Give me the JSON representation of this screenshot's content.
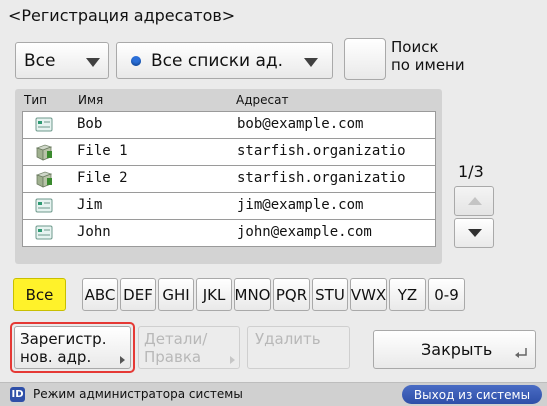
{
  "screen": {
    "title": "<Регистрация адресатов>"
  },
  "filters": {
    "type_filter": "Все",
    "list_filter": "Все списки ад.",
    "search_button_label": "Поиск\nпо имени"
  },
  "table": {
    "headers": {
      "type": "Тип",
      "name": "Имя",
      "address": "Адресат"
    },
    "rows": [
      {
        "type_icon": "address-card-icon",
        "name": "Bob",
        "address": "bob@example.com"
      },
      {
        "type_icon": "file-server-icon",
        "name": "File 1",
        "address": "starfish.organizatio"
      },
      {
        "type_icon": "file-server-icon",
        "name": "File 2",
        "address": "starfish.organizatio"
      },
      {
        "type_icon": "address-card-icon",
        "name": "Jim",
        "address": "jim@example.com"
      },
      {
        "type_icon": "address-card-icon",
        "name": "John",
        "address": "john@example.com"
      }
    ]
  },
  "pager": {
    "page_indicator": "1/3",
    "up_icon": "scroll-up-icon",
    "down_icon": "scroll-down-icon"
  },
  "alpha_tabs": [
    {
      "label": "Все",
      "active": true
    },
    {
      "label": "ABC",
      "active": false
    },
    {
      "label": "DEF",
      "active": false
    },
    {
      "label": "GHI",
      "active": false
    },
    {
      "label": "JKL",
      "active": false
    },
    {
      "label": "MNO",
      "active": false
    },
    {
      "label": "PQR",
      "active": false
    },
    {
      "label": "STU",
      "active": false
    },
    {
      "label": "VWX",
      "active": false
    },
    {
      "label": "YZ",
      "active": false
    },
    {
      "label": "0-9",
      "active": false
    }
  ],
  "actions": {
    "register_label": "Зарегистр.\nнов. адр.",
    "edit_label": "Детали/\nПравка",
    "delete_label": "Удалить",
    "close_label": "Закрыть"
  },
  "status_bar": {
    "id_badge": "ID",
    "mode_text": "Режим администратора системы",
    "logout_label": "Выход из системы"
  },
  "colors": {
    "active_tab": "#fff22a",
    "highlight_outline": "#e53935",
    "logout_button": "#2e4fa8"
  }
}
